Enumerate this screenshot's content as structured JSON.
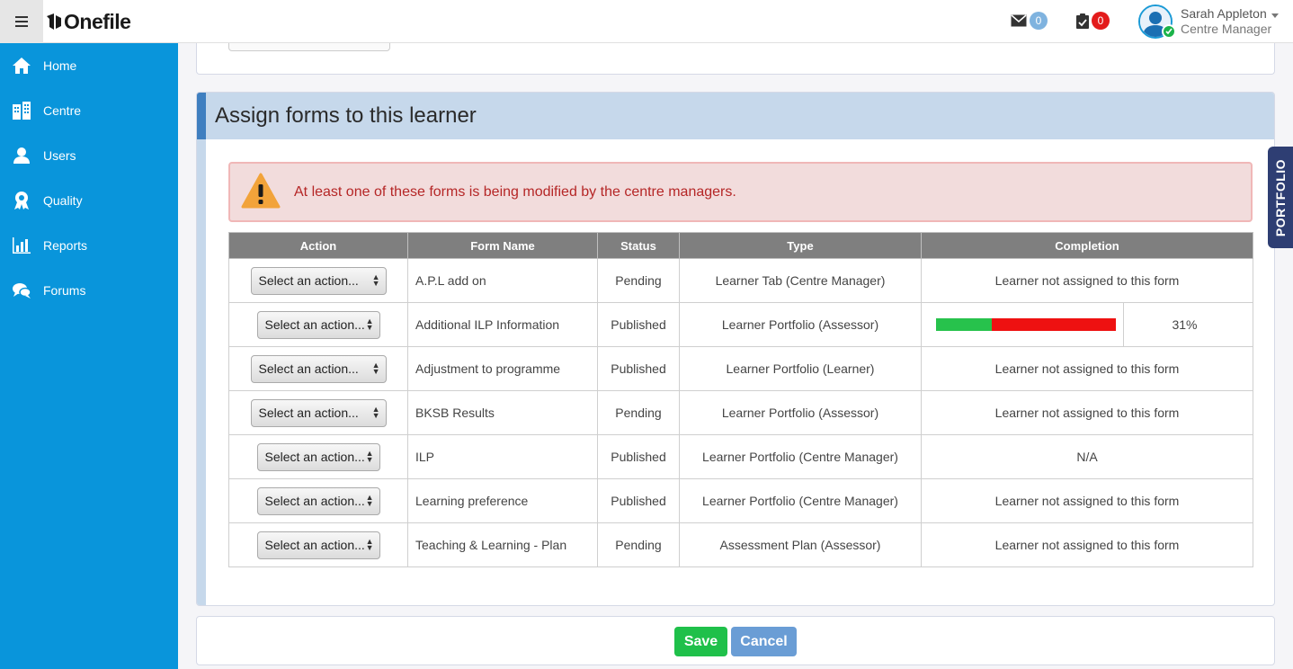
{
  "app": {
    "logo_text": "Onefile"
  },
  "topbar": {
    "messages_icon": "envelope-icon",
    "messages_count": "0",
    "messages_badge_color": "#7fb3df",
    "tasks_icon": "clipboard-icon",
    "tasks_count": "0",
    "tasks_badge_color": "#e31b1b",
    "user_name": "Sarah Appleton",
    "user_role": "Centre Manager"
  },
  "sidebar": {
    "items": [
      {
        "label": "Home",
        "icon": "home-icon"
      },
      {
        "label": "Centre",
        "icon": "building-icon"
      },
      {
        "label": "Users",
        "icon": "users-icon"
      },
      {
        "label": "Quality",
        "icon": "quality-icon"
      },
      {
        "label": "Reports",
        "icon": "bar-chart-icon"
      },
      {
        "label": "Forums",
        "icon": "chat-bubbles-icon"
      }
    ]
  },
  "panel": {
    "title": "Assign forms to this learner"
  },
  "alert": {
    "icon": "warning-icon",
    "text": "At least one of these forms is being modified by the centre managers."
  },
  "table": {
    "headers": [
      "Action",
      "Form Name",
      "Status",
      "Type",
      "Completion"
    ],
    "select_placeholder": "Select an action...",
    "rows": [
      {
        "action": "Select an action...",
        "name": "A.P.L add on",
        "status": "Pending",
        "type": "Learner Tab (Centre Manager)",
        "completion": "Learner not assigned to this form"
      },
      {
        "action": "Select an action...",
        "name": "Additional ILP Information",
        "status": "Published",
        "type": "Learner Portfolio (Assessor)",
        "completion_pct": "31%",
        "completion_fraction": 0.31
      },
      {
        "action": "Select an action...",
        "name": "Adjustment to programme",
        "status": "Published",
        "type": "Learner Portfolio (Learner)",
        "completion": "Learner not assigned to this form"
      },
      {
        "action": "Select an action...",
        "name": "BKSB Results",
        "status": "Pending",
        "type": "Learner Portfolio (Assessor)",
        "completion": "Learner not assigned to this form"
      },
      {
        "action": "Select an action...",
        "name": "ILP",
        "status": "Published",
        "type": "Learner Portfolio (Centre Manager)",
        "completion": "N/A"
      },
      {
        "action": "Select an action...",
        "name": "Learning preference",
        "status": "Published",
        "type": "Learner Portfolio (Centre Manager)",
        "completion": "Learner not assigned to this form"
      },
      {
        "action": "Select an action...",
        "name": "Teaching & Learning - Plan",
        "status": "Pending",
        "type": "Assessment Plan (Assessor)",
        "completion": "Learner not assigned to this form"
      }
    ]
  },
  "buttons": {
    "save": "Save",
    "cancel": "Cancel"
  },
  "portfolio_tab": {
    "label": "PORTFOLIO"
  },
  "colors": {
    "sidebar": "#0995db",
    "header_bg": "#c6d8eb",
    "save": "#1fc04a",
    "cancel": "#6a9dd5",
    "progress_done": "#27c24c",
    "progress_remaining": "#ee1111"
  }
}
